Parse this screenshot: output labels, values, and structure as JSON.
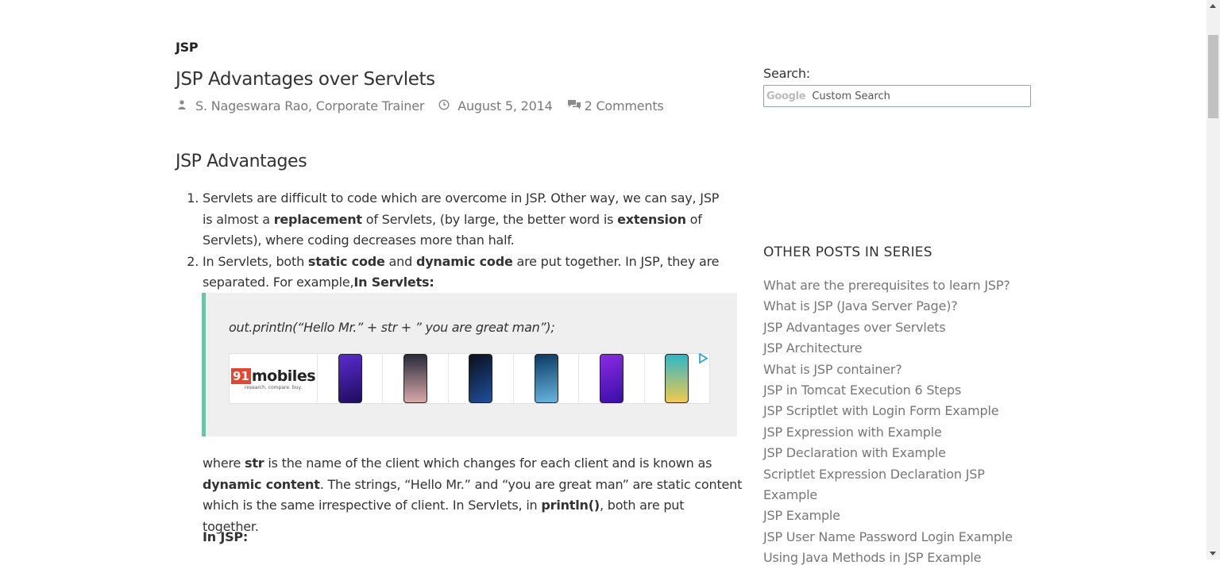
{
  "post": {
    "category": "JSP",
    "title": "JSP Advantages over Servlets",
    "author": "S. Nageswara Rao, Corporate Trainer",
    "date": "August 5, 2014",
    "comments": "2 Comments"
  },
  "icons": {
    "author": "user-icon",
    "date": "clock-icon",
    "comments": "comments-icon",
    "ad_choice": "adchoices-icon"
  },
  "article": {
    "section_heading": "JSP Advantages",
    "items": [
      {
        "parts": [
          "Servlets are difficult to code which are overcome in JSP. Other way, we can say, JSP is almost a ",
          "replacement",
          " of Servlets, (by large, the better word is ",
          "extension",
          " of Servlets), where coding decreases more than half."
        ]
      },
      {
        "parts": [
          "In Servlets, both ",
          "static code",
          " and ",
          "dynamic code",
          " are put together. In JSP, they are separated. For example,",
          "In Servlets:"
        ]
      }
    ],
    "code_line": "out.println(“Hello Mr.” + str + ” you are great man”);",
    "after_parts": [
      "where ",
      "str",
      " is the name of the client which changes for each client and is known as ",
      "dynamic content",
      ". The strings, “Hello Mr.” and “you are great man” are static content which is the same irrespective of client. In Servlets, in ",
      "println()",
      ", both are put together."
    ],
    "in_jsp_label": "In JSP:"
  },
  "ad": {
    "logo_number": "91",
    "logo_brand": "mobiles",
    "logo_tagline": "research. compare. buy.",
    "phone_colors": [
      "#3b1f8a",
      "#c9a6a6",
      "#0d2a55",
      "#0b3a66",
      "#5a1fc4",
      "#2fb6c9"
    ]
  },
  "sidebar": {
    "search_label": "Search:",
    "search_logo": "Google",
    "search_placeholder": "Custom Search",
    "series_heading": "OTHER POSTS IN SERIES",
    "series": [
      "What are the prerequisites to learn JSP?",
      "What is JSP (Java Server Page)?",
      "JSP Advantages over Servlets",
      "JSP Architecture",
      "What is JSP container?",
      "JSP in Tomcat Execution 6 Steps",
      "JSP Scriptlet with Login Form Example",
      "JSP Expression with Example",
      "JSP Declaration with Example",
      "Scriptlet Expression Declaration JSP Example",
      "JSP Example",
      "JSP User Name Password Login Example",
      "Using Java Methods in JSP Example"
    ]
  },
  "colors": {
    "quote_border": "#6cc3a7",
    "quote_bg": "#efefef",
    "link_muted": "#777777"
  }
}
